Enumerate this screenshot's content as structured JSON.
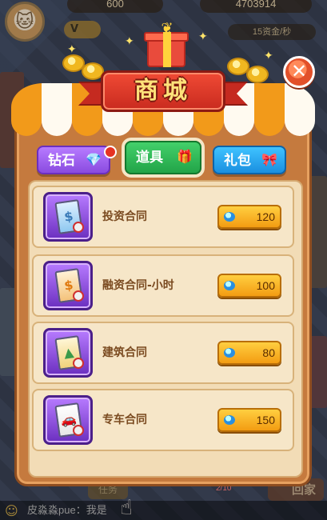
{
  "hud": {
    "resource_a": "600",
    "resource_b": "4703914",
    "income_rate": "15资金/秒"
  },
  "shop": {
    "title": "商城",
    "close_symbol": "✕",
    "tabs": [
      {
        "label": "钻石",
        "icon": "diamond-icon"
      },
      {
        "label": "道具",
        "icon": "item-box-icon",
        "active": true
      },
      {
        "label": "礼包",
        "icon": "gift-icon"
      }
    ],
    "items": [
      {
        "name": "投资合同",
        "price": "120",
        "icon": "investment-contract-icon"
      },
      {
        "name": "融资合同-小时",
        "price": "100",
        "icon": "financing-contract-icon"
      },
      {
        "name": "建筑合同",
        "price": "80",
        "icon": "construction-contract-icon"
      },
      {
        "name": "专车合同",
        "price": "150",
        "icon": "car-contract-icon"
      }
    ]
  },
  "bottom": {
    "home_label": "回家",
    "task_label": "任务",
    "progress": "2/10",
    "chat_text": "皮淼淼pue：我是"
  },
  "colors": {
    "awning_orange": "#f29a1a",
    "banner_red": "#c92b1f",
    "price_gold": "#f39c12",
    "tab_purple": "#8a4be0",
    "tab_green": "#22a448",
    "tab_blue": "#1a8fe0"
  }
}
